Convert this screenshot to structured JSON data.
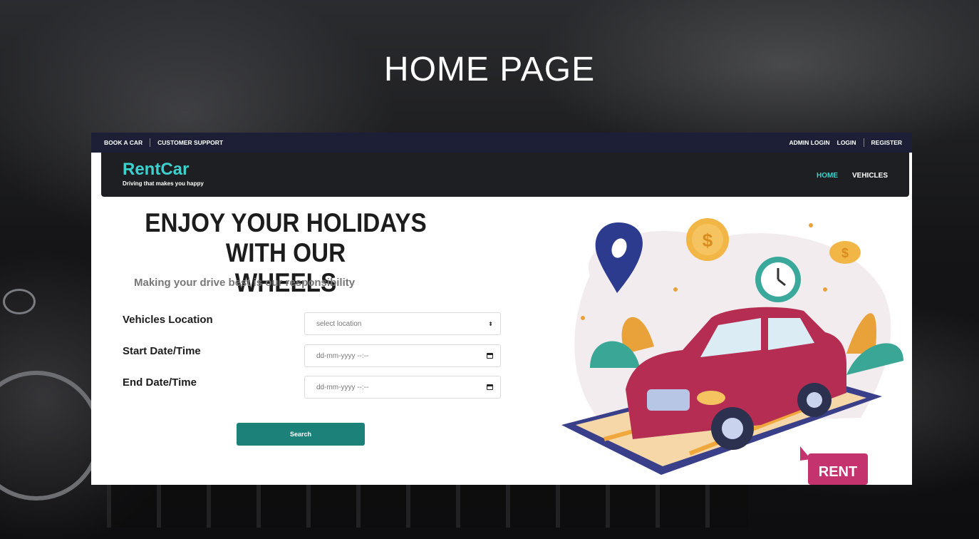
{
  "slide": {
    "title": "HOME PAGE"
  },
  "topbar": {
    "left_links": [
      "BOOK A CAR",
      "CUSTOMER SUPPORT"
    ],
    "right_links": [
      "ADMIN LOGIN",
      "LOGIN",
      "REGISTER"
    ]
  },
  "brand": {
    "name": "RentCar",
    "tagline": "Driving that makes you happy"
  },
  "nav": {
    "home": "HOME",
    "vehicles": "VEHICLES"
  },
  "hero": {
    "title_line1": "ENJOY YOUR HOLIDAYS WITH OUR",
    "title_line2": "WHEELS",
    "subtitle": "Making your drive best is our responsibility"
  },
  "form": {
    "location_label": "Vehicles Location",
    "location_value": "select location",
    "start_label": "Start Date/Time",
    "start_placeholder": "dd-mm-yyyy --:--",
    "end_label": "End Date/Time",
    "end_placeholder": "dd-mm-yyyy --:--",
    "search_label": "Search"
  },
  "illustration": {
    "badge": "RENT",
    "currency_symbol": "$"
  },
  "colors": {
    "accent": "#3bd1ce",
    "button": "#1c8279",
    "topbar": "#1c1f35",
    "navbar": "#1e1f22"
  }
}
